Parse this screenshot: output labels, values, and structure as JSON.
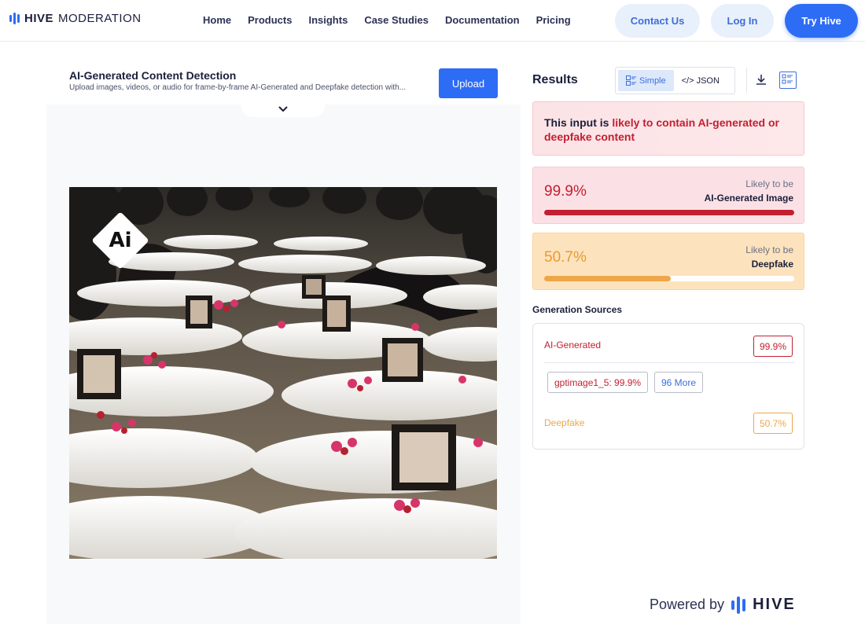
{
  "nav": {
    "brand_bold": "HIVE",
    "brand_light": "MODERATION",
    "links": [
      "Home",
      "Products",
      "Insights",
      "Case Studies",
      "Documentation",
      "Pricing"
    ],
    "contact_label": "Contact Us",
    "login_label": "Log In",
    "try_label": "Try Hive"
  },
  "upload_panel": {
    "title": "AI-Generated Content Detection",
    "subtitle": "Upload images, videos, or audio for frame-by-frame AI-Generated and Deepfake detection with...",
    "upload_label": "Upload",
    "image_badge": "Ai"
  },
  "results": {
    "title": "Results",
    "view_simple": "Simple",
    "view_json": "</> JSON",
    "verdict_prefix": "This input is ",
    "verdict_highlight": "likely to contain AI-generated or deepfake content",
    "cards": [
      {
        "percent": "99.9%",
        "likely": "Likely to be",
        "label": "AI-Generated Image",
        "fill": 0.999,
        "color": "#c21f31"
      },
      {
        "percent": "50.7%",
        "likely": "Likely to be",
        "label": "Deepfake",
        "fill": 0.507,
        "color": "#eea64a"
      }
    ],
    "sources_title": "Generation Sources",
    "sources": {
      "ai_label": "AI-Generated",
      "ai_value": "99.9%",
      "model_tag": "gptimage1_5: 99.9%",
      "more_tag": "96 More",
      "deepfake_label": "Deepfake",
      "deepfake_value": "50.7%"
    }
  },
  "footer": {
    "powered_by": "Powered by",
    "brand": "HIVE"
  },
  "colors": {
    "accent": "#2d6cf5",
    "danger": "#c21f31",
    "warning": "#eea64a"
  }
}
